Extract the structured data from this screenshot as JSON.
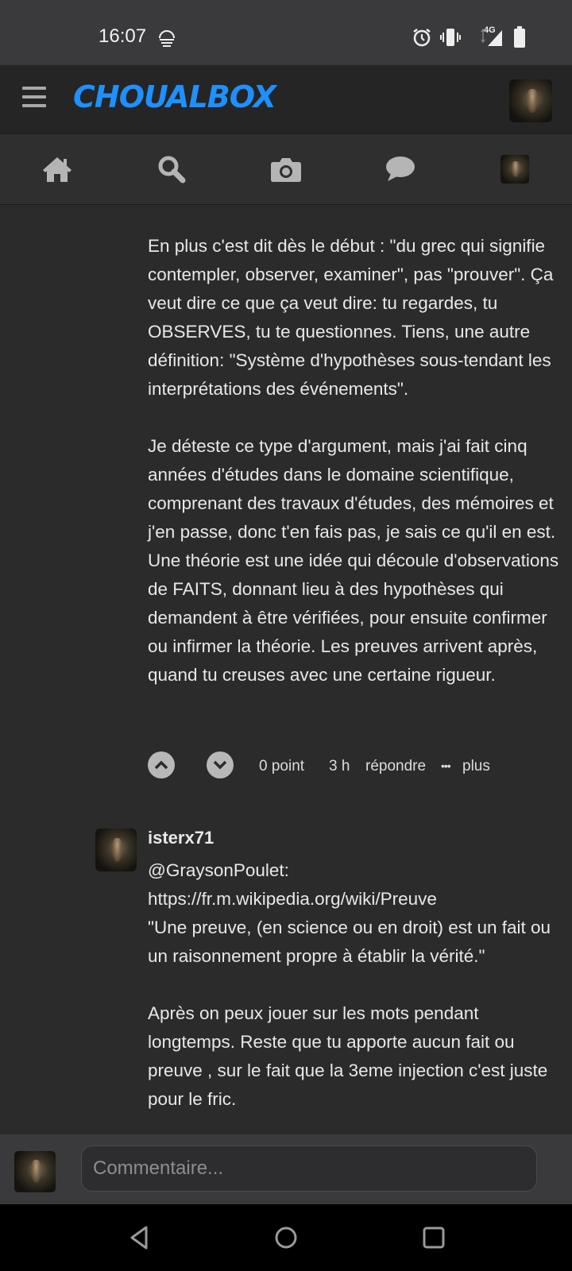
{
  "status_bar": {
    "time": "16:07",
    "network": "4G",
    "icons": [
      "vpn-icon",
      "alarm-icon",
      "vibrate-icon",
      "signal-icon",
      "battery-icon"
    ]
  },
  "header": {
    "logo": "CHOUALBOX",
    "logo_color": "#1e90ff"
  },
  "nav": {
    "items": [
      "home-icon",
      "search-icon",
      "camera-icon",
      "chat-icon",
      "profile-avatar"
    ]
  },
  "comment1": {
    "paragraphs": [
      "En plus c'est dit dès le début : \"du grec qui signifie contempler, observer, examiner\", pas \"prouver\". Ça veut dire ce que ça veut dire: tu regardes, tu OBSERVES, tu te questionnes. Tiens, une autre définition: \"Système d'hypothèses sous-tendant les interprétations des événements\".",
      "Je déteste ce type d'argument, mais j'ai fait cinq années d'études dans le domaine scientifique, comprenant des travaux d'études, des mémoires et j'en passe, donc t'en fais pas, je sais ce qu'il en est. Une théorie est une idée qui découle d'observations de FAITS, donnant lieu à des hypothèses qui demandent à être vérifiées, pour ensuite confirmer ou infirmer la théorie. Les preuves arrivent après, quand tu creuses avec une certaine rigueur."
    ],
    "points": "0 point",
    "age": "3 h",
    "reply": "répondre",
    "more_dots": "•••",
    "more": "plus"
  },
  "comment2": {
    "username": "isterx71",
    "lines": [
      "@GraysonPoulet:",
      "https://fr.m.wikipedia.org/wiki/Preuve",
      "\"Une preuve, (en science ou en droit) est un fait ou un raisonnement propre à établir la vérité.\""
    ],
    "paragraph2": "Après on peux jouer sur les mots pendant longtemps. Reste que tu apporte aucun fait ou preuve , sur le fait que la 3eme injection c'est juste pour le fric."
  },
  "composer": {
    "placeholder": "Commentaire..."
  }
}
